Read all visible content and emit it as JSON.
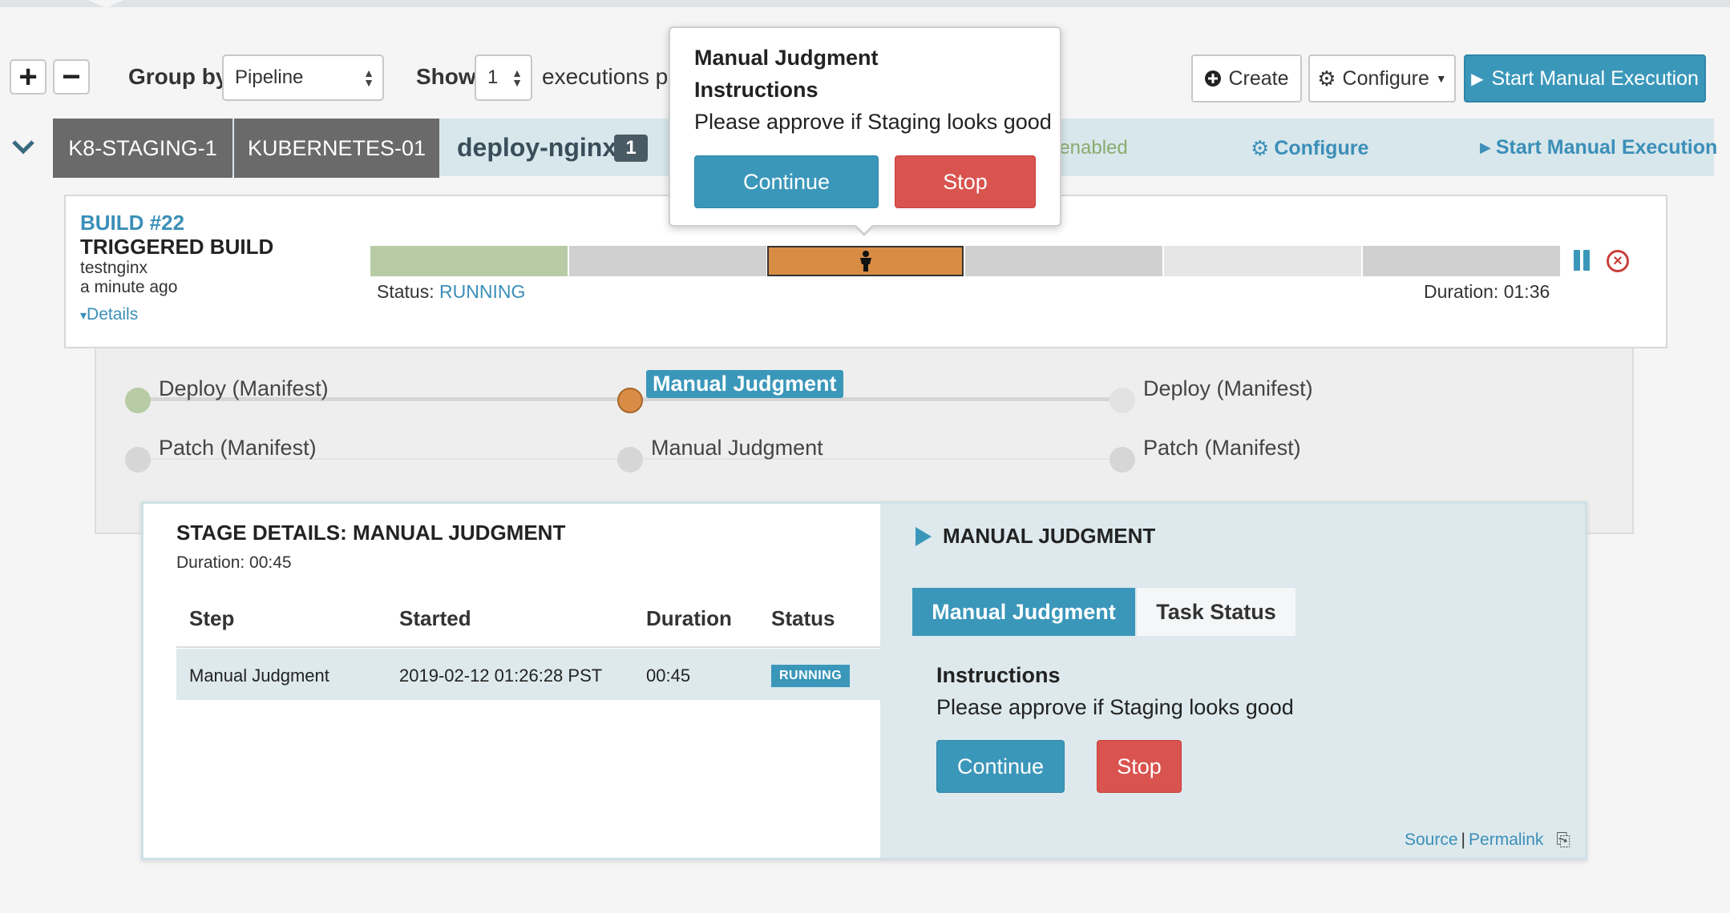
{
  "toolbar": {
    "expand_label": "+",
    "collapse_label": "−",
    "group_by_label": "Group by",
    "group_by_value": "Pipeline",
    "show_label": "Show",
    "show_value": "1",
    "executions_text": "executions pe",
    "create_label": "Create",
    "configure_label": "Configure",
    "start_manual_label": "Start Manual Execution"
  },
  "pipeline_header": {
    "tags": [
      "K8-STAGING-1",
      "KUBERNETES-01"
    ],
    "name": "deploy-nginx",
    "count": "1",
    "trigger_status": ": enabled",
    "configure_label": "Configure",
    "start_manual_label": "Start Manual Execution"
  },
  "execution": {
    "build": "BUILD #22",
    "trigger_type": "TRIGGERED BUILD",
    "user": "testnginx",
    "time_ago": "a minute ago",
    "details_label": "Details",
    "status_label": "Status:",
    "status_value": "RUNNING",
    "duration_label": "Duration: 01:36",
    "progress_segments": [
      "succeeded",
      "not-started",
      "running",
      "not-started",
      "not-started-light",
      "not-started"
    ]
  },
  "graph": {
    "nodes": [
      {
        "label": "Deploy (Manifest)",
        "state": "succeeded"
      },
      {
        "label": "Manual Judgment",
        "state": "running"
      },
      {
        "label": "Deploy (Manifest)",
        "state": "not-started"
      },
      {
        "label": "Patch (Manifest)",
        "state": "not-started"
      },
      {
        "label": "Manual Judgment",
        "state": "not-started"
      },
      {
        "label": "Patch (Manifest)",
        "state": "not-started"
      }
    ]
  },
  "stage_details": {
    "title": "STAGE DETAILS: MANUAL JUDGMENT",
    "duration": "Duration: 00:45",
    "columns": [
      "Step",
      "Started",
      "Duration",
      "Status"
    ],
    "rows": [
      {
        "step": "Manual Judgment",
        "started": "2019-02-12 01:26:28 PST",
        "duration": "00:45",
        "status": "RUNNING"
      }
    ]
  },
  "judgment_panel": {
    "heading": "MANUAL JUDGMENT",
    "tabs": [
      "Manual Judgment",
      "Task Status"
    ],
    "instructions_heading": "Instructions",
    "instructions_text": "Please approve if Staging looks good",
    "continue_label": "Continue",
    "stop_label": "Stop",
    "source_label": "Source",
    "separator": "|",
    "permalink_label": "Permalink"
  },
  "popover": {
    "title": "Manual Judgment",
    "instructions_heading": "Instructions",
    "instructions_text": "Please approve if Staging looks good",
    "continue_label": "Continue",
    "stop_label": "Stop"
  },
  "colors": {
    "accent": "#3b97ba",
    "succeeded": "#b7cca4",
    "running": "#d98c45",
    "danger": "#d9534f"
  }
}
